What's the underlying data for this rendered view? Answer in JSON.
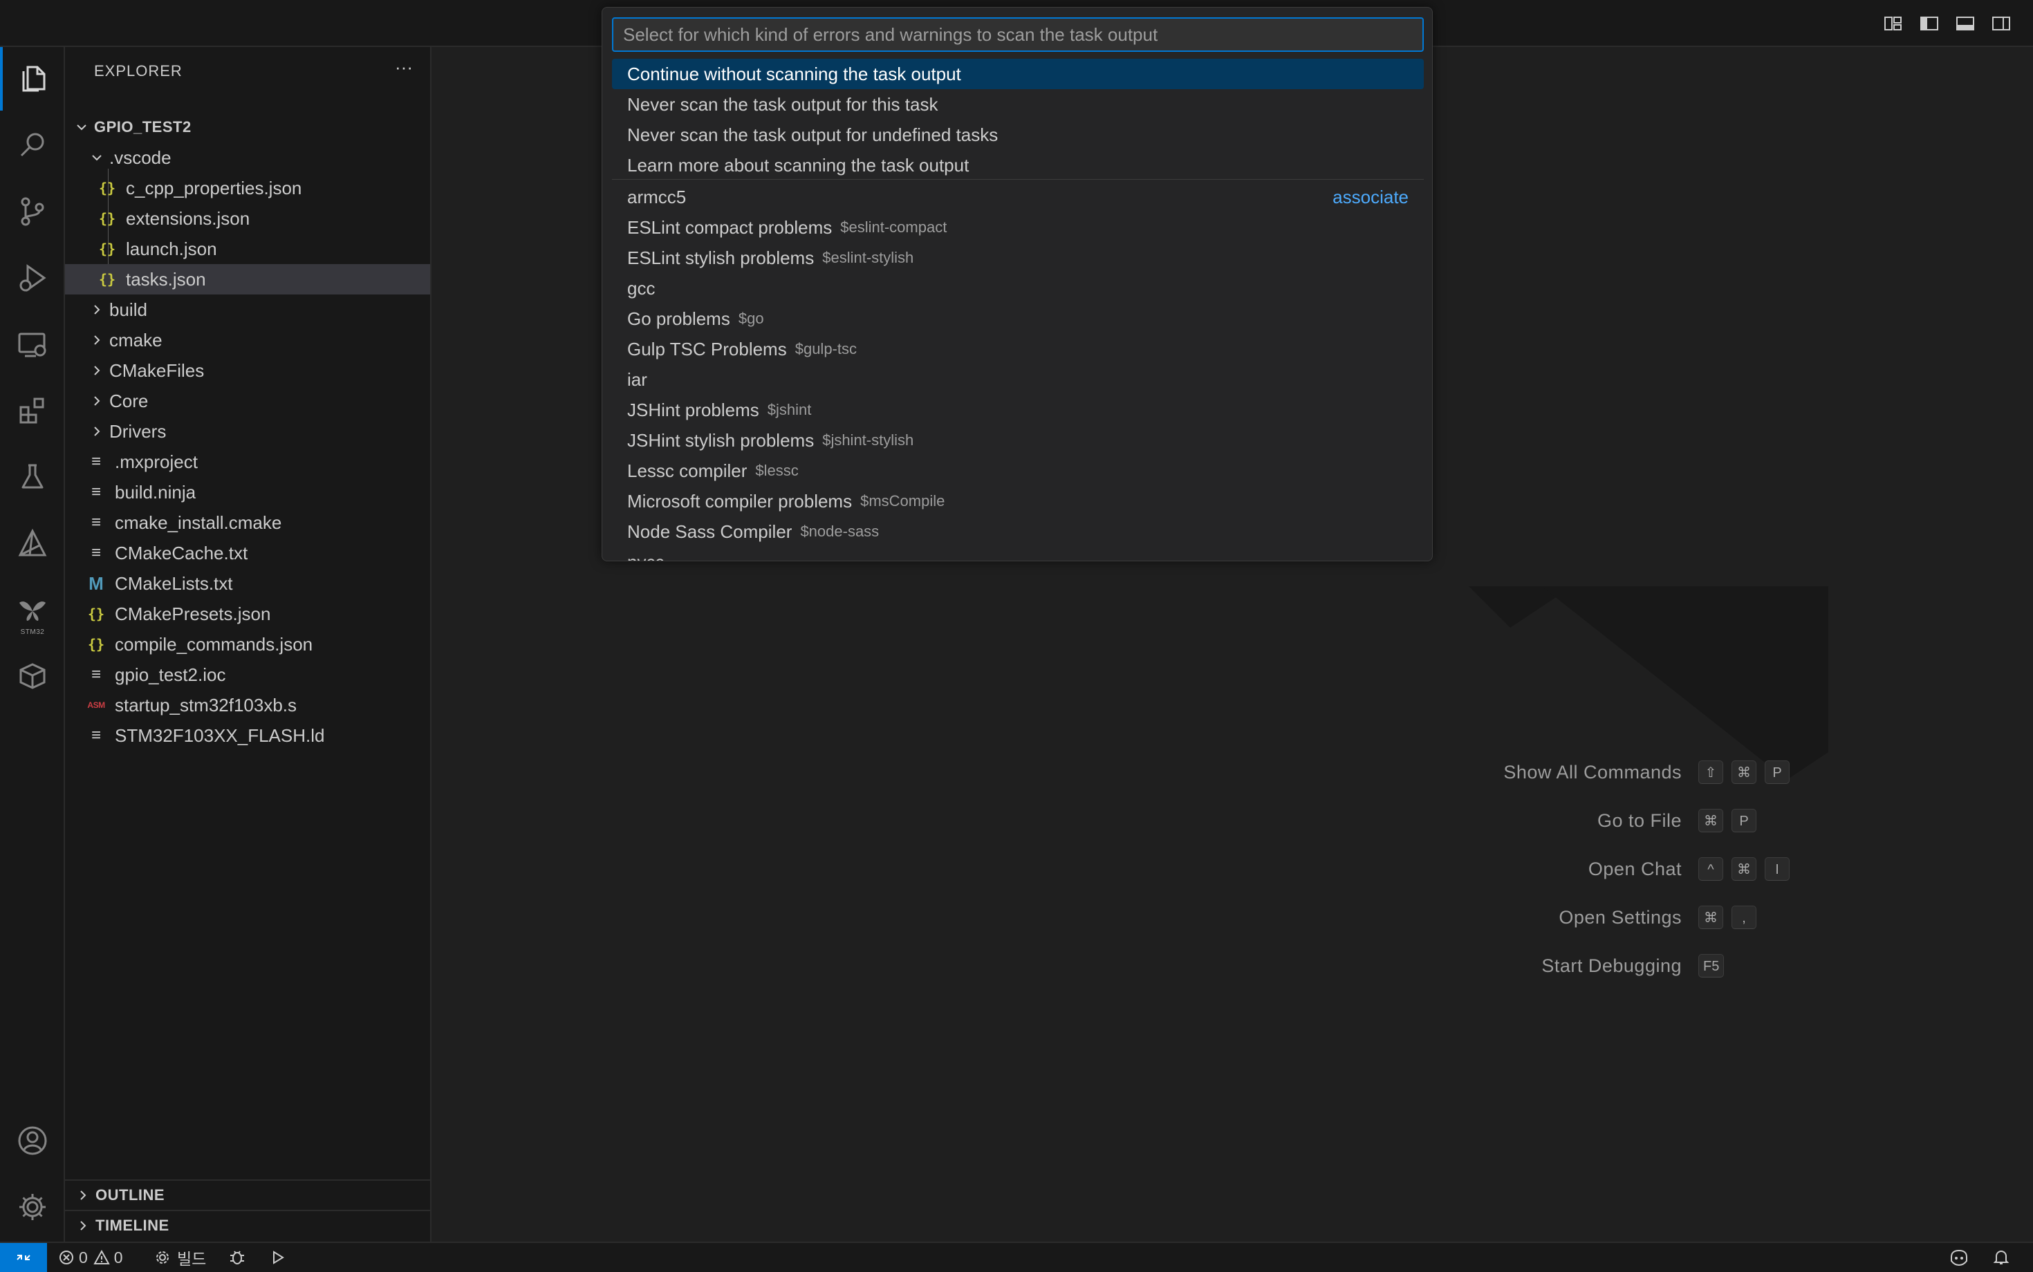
{
  "quickpick": {
    "placeholder": "Select for which kind of errors and warnings to scan the task output",
    "options": [
      "Continue without scanning the task output",
      "Never scan the task output for this task",
      "Never scan the task output for undefined tasks",
      "Learn more about scanning the task output"
    ],
    "matchers": [
      {
        "label": "armcc5",
        "desc": "",
        "action": "associate"
      },
      {
        "label": "ESLint compact problems",
        "desc": "$eslint-compact"
      },
      {
        "label": "ESLint stylish problems",
        "desc": "$eslint-stylish"
      },
      {
        "label": "gcc",
        "desc": ""
      },
      {
        "label": "Go problems",
        "desc": "$go"
      },
      {
        "label": "Gulp TSC Problems",
        "desc": "$gulp-tsc"
      },
      {
        "label": "iar",
        "desc": ""
      },
      {
        "label": "JSHint problems",
        "desc": "$jshint"
      },
      {
        "label": "JSHint stylish problems",
        "desc": "$jshint-stylish"
      },
      {
        "label": "Lessc compiler",
        "desc": "$lessc"
      },
      {
        "label": "Microsoft compiler problems",
        "desc": "$msCompile"
      },
      {
        "label": "Node Sass Compiler",
        "desc": "$node-sass"
      },
      {
        "label": "nvcc",
        "desc": ""
      }
    ]
  },
  "explorer": {
    "title": "EXPLORER",
    "more": "···",
    "root": "GPIO_TEST2",
    "vscode_folder": ".vscode",
    "vscode_files": [
      "c_cpp_properties.json",
      "extensions.json",
      "launch.json",
      "tasks.json"
    ],
    "folders": [
      "build",
      "cmake",
      "CMakeFiles",
      "Core",
      "Drivers"
    ],
    "files": [
      {
        "name": ".mxproject",
        "icon": "lines-icon"
      },
      {
        "name": "build.ninja",
        "icon": "lines-icon"
      },
      {
        "name": "cmake_install.cmake",
        "icon": "lines-icon"
      },
      {
        "name": "CMakeCache.txt",
        "icon": "lines-icon"
      },
      {
        "name": "CMakeLists.txt",
        "icon": "m-icon"
      },
      {
        "name": "CMakePresets.json",
        "icon": "json-icon"
      },
      {
        "name": "compile_commands.json",
        "icon": "json-icon"
      },
      {
        "name": "gpio_test2.ioc",
        "icon": "lines-icon"
      },
      {
        "name": "startup_stm32f103xb.s",
        "icon": "asm-icon"
      },
      {
        "name": "STM32F103XX_FLASH.ld",
        "icon": "lines-icon"
      }
    ],
    "icon_glyphs": {
      "json": "{}",
      "lines": "≡",
      "m": "M",
      "asm": "ASM"
    },
    "sections": [
      "OUTLINE",
      "TIMELINE"
    ]
  },
  "activity": {
    "stm32_label": "STM32"
  },
  "commands": [
    {
      "label": "Show All Commands",
      "keys": [
        "⇧",
        "⌘",
        "P"
      ]
    },
    {
      "label": "Go to File",
      "keys": [
        "⌘",
        "P"
      ]
    },
    {
      "label": "Open Chat",
      "keys": [
        "^",
        "⌘",
        "I"
      ]
    },
    {
      "label": "Open Settings",
      "keys": [
        "⌘",
        ","
      ]
    },
    {
      "label": "Start Debugging",
      "keys": [
        "F5"
      ]
    }
  ],
  "statusbar": {
    "errors": "0",
    "warnings": "0",
    "build_label": "빌드"
  },
  "colors": {
    "accent": "#0078d4",
    "selection": "#04395e",
    "link": "#4daafc"
  }
}
